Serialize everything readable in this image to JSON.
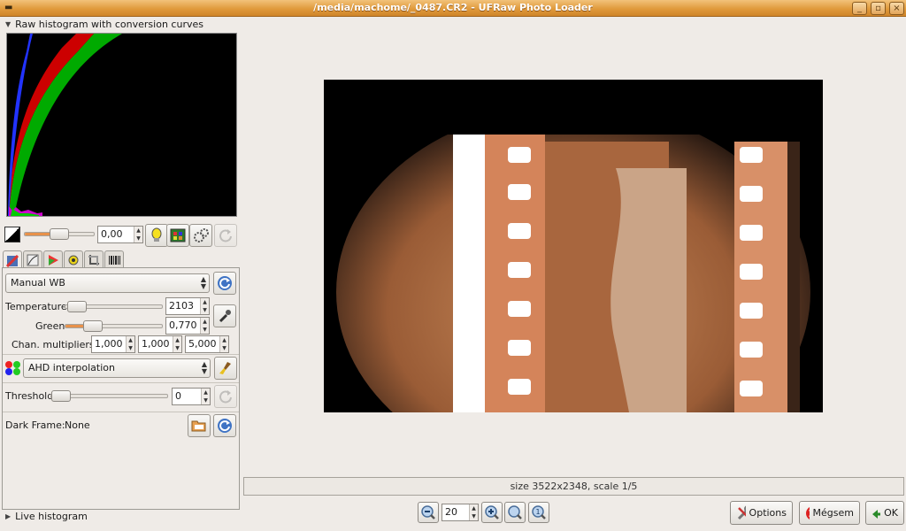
{
  "window": {
    "title": "/media/machome/_0487.CR2 - UFRaw Photo Loader"
  },
  "histogram_panel": {
    "label": "Raw histogram with conversion curves"
  },
  "exposure": {
    "value": "0,00",
    "slider_fraction": 0.5
  },
  "tabs": [
    "white-balance",
    "base-curve",
    "color-management",
    "correction",
    "crop-rotate",
    "exif"
  ],
  "white_balance": {
    "preset": "Manual WB",
    "temperature_label": "Temperature",
    "temperature_value": "2103",
    "temperature_fraction": 0.05,
    "green_label": "Green",
    "green_value": "0,770",
    "green_fraction": 0.2,
    "multipliers_label": "Chan. multipliers:",
    "multipliers": [
      "1,000",
      "1,000",
      "5,000"
    ]
  },
  "interpolation": {
    "value": "AHD interpolation"
  },
  "threshold": {
    "label": "Threshold",
    "value": "0",
    "fraction": 0.0
  },
  "dark_frame": {
    "label": "Dark Frame:",
    "value": "None"
  },
  "live_histogram": {
    "label": "Live histogram"
  },
  "status": {
    "text": "size 3522x2348, scale 1/5"
  },
  "zoom": {
    "value": "20"
  },
  "buttons": {
    "options": "Options",
    "cancel": "Mégsem",
    "ok": "OK"
  },
  "colors": {
    "titlebar": "#e09a3c",
    "slider_fill": "#e8914a",
    "histogram_red": "#cc0000",
    "histogram_green": "#00aa00",
    "histogram_blue": "#2233ff"
  }
}
